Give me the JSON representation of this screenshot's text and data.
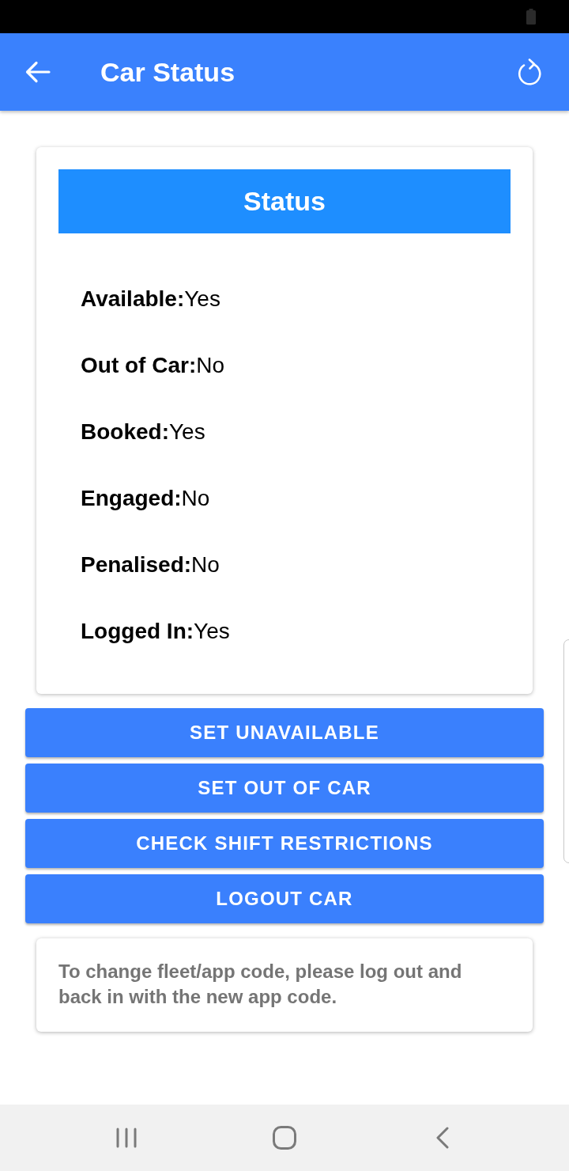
{
  "app_bar": {
    "title": "Car Status"
  },
  "status_card": {
    "heading": "Status",
    "rows": [
      {
        "label": "Available:",
        "value": "Yes"
      },
      {
        "label": "Out of Car:",
        "value": "No"
      },
      {
        "label": "Booked:",
        "value": "Yes"
      },
      {
        "label": "Engaged:",
        "value": "No"
      },
      {
        "label": "Penalised:",
        "value": "No"
      },
      {
        "label": "Logged In:",
        "value": "Yes"
      }
    ]
  },
  "buttons": [
    "SET UNAVAILABLE",
    "SET OUT OF CAR",
    "CHECK SHIFT RESTRICTIONS",
    "LOGOUT CAR"
  ],
  "note": "To change fleet/app code, please log out and back in with the new app code."
}
